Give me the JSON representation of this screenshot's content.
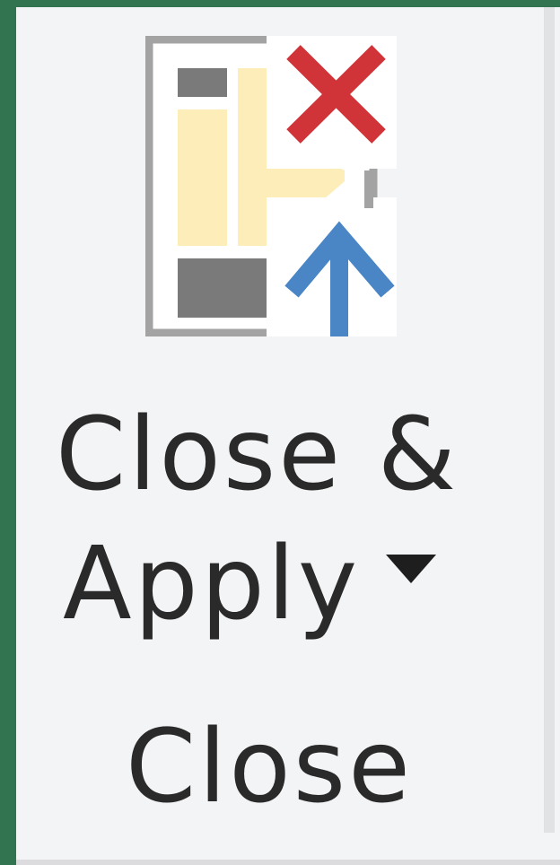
{
  "ribbon_group": {
    "button": {
      "label_line1": "Close &",
      "label_line2": "Apply",
      "icon": "close-and-apply-icon",
      "has_dropdown": true
    },
    "caption": "Close"
  },
  "colors": {
    "window_frame": "#31744f",
    "panel_background": "#f3f4f6",
    "text": "#2a2a2a",
    "close_x": "#d13438",
    "apply_arrow": "#4a86c5",
    "table_highlight": "#fdedb9",
    "table_header": "#7a7a7a"
  }
}
